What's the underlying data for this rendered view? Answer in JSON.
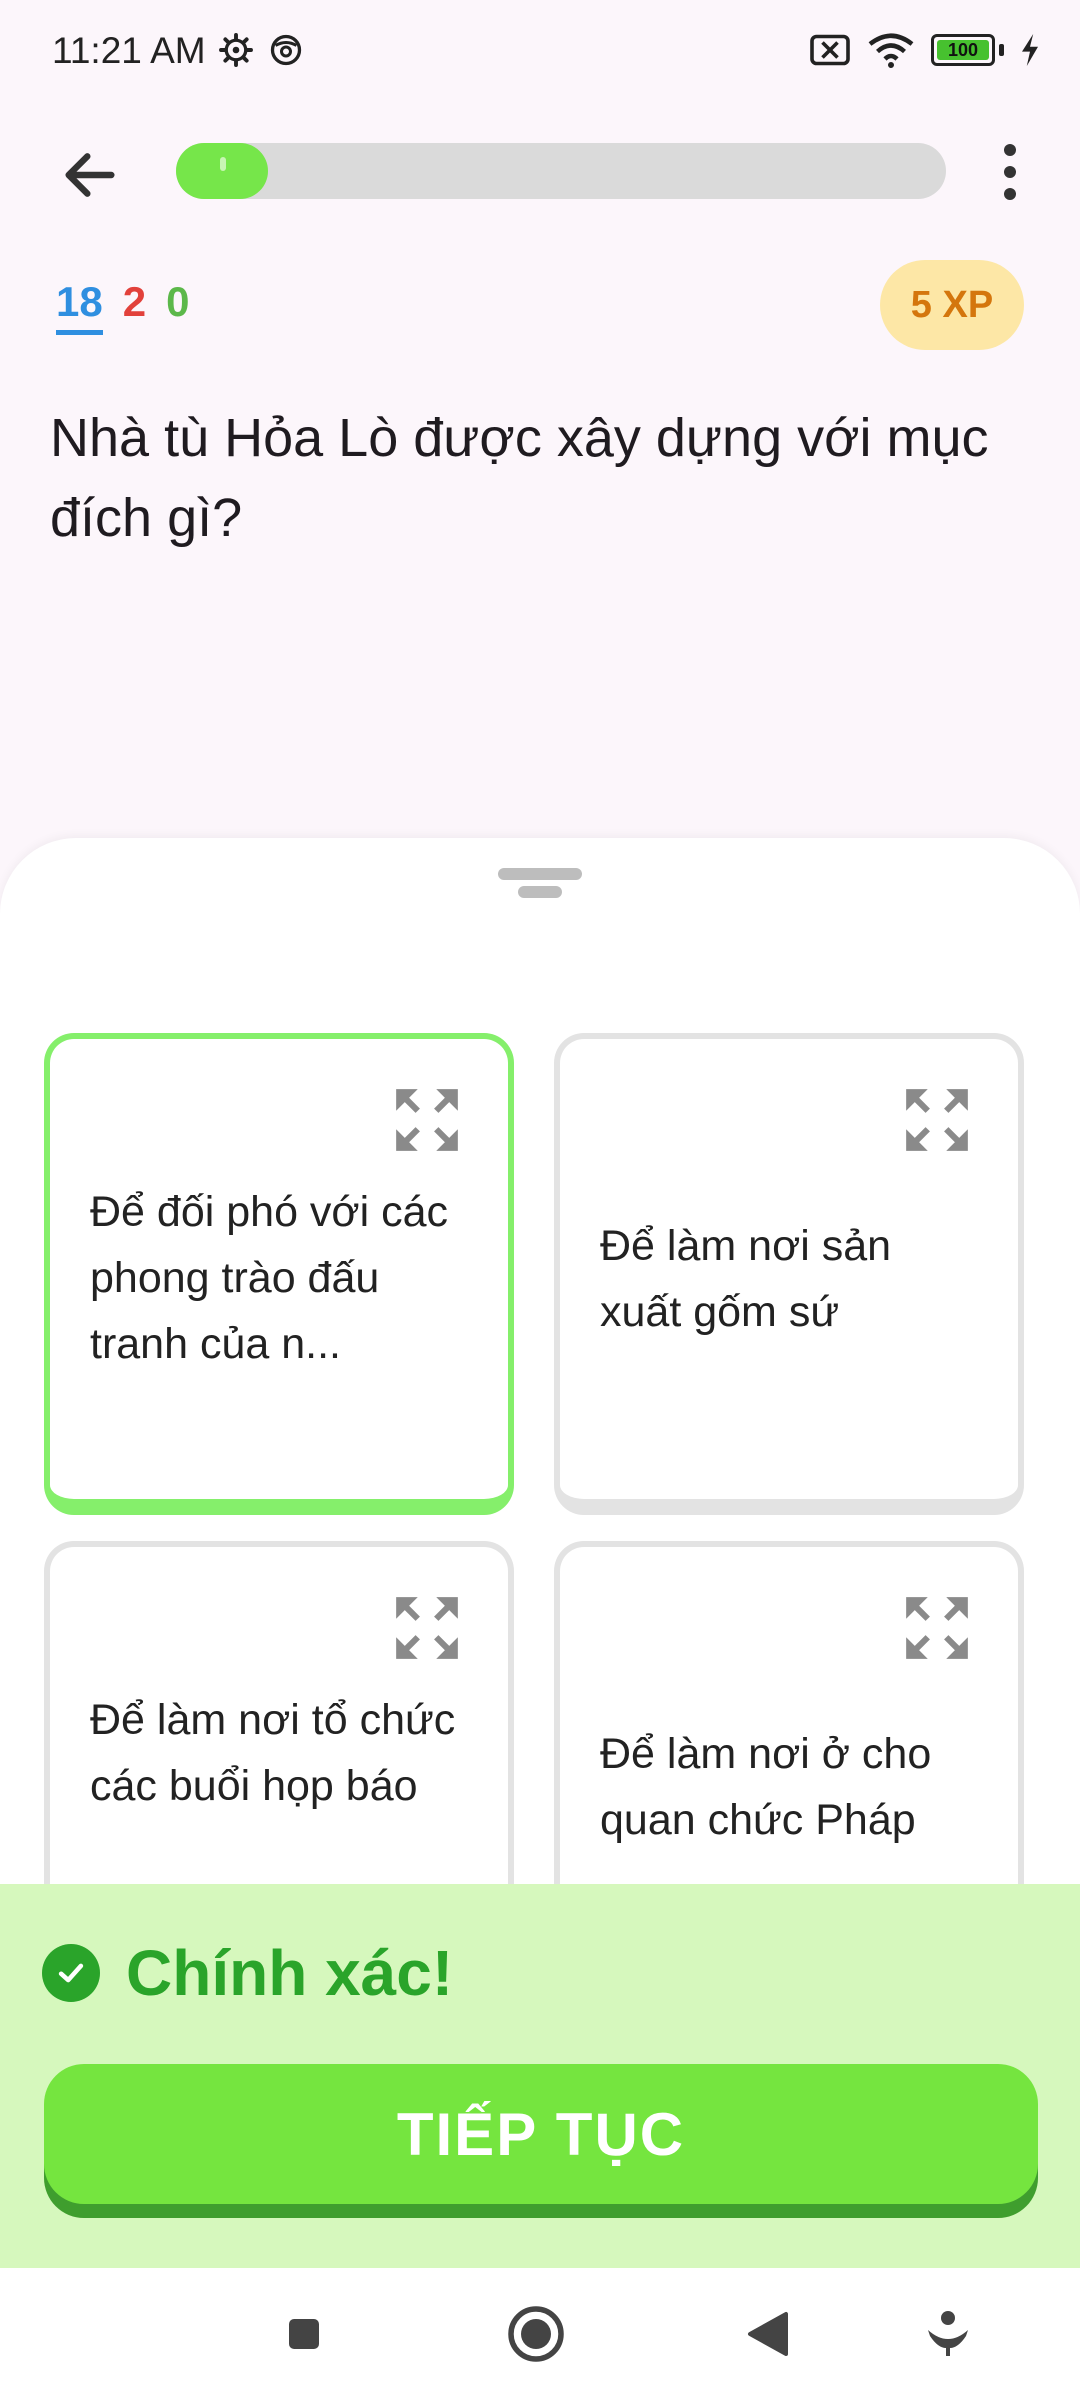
{
  "status_bar": {
    "time": "11:21 AM",
    "battery": "100",
    "icons": [
      "settings-icon",
      "vpn-icon",
      "no-sim-icon",
      "wifi-icon",
      "battery-icon",
      "charging-icon"
    ]
  },
  "header": {
    "progress_fraction": 0.12,
    "icons": [
      "back-arrow-icon",
      "more-vert-icon"
    ]
  },
  "stats": {
    "correct": "18",
    "wrong": "2",
    "skipped": "0",
    "colors": {
      "correct": "#2f8fe0",
      "wrong": "#e2413b",
      "skipped": "#5cb84a"
    }
  },
  "xp_badge": "5 XP",
  "question": "Nhà tù Hỏa Lò được xây dựng với mục đích gì?",
  "answers": [
    {
      "text": "Để đối phó với các phong trào đấu tranh của n...",
      "selected": true
    },
    {
      "text": "Để làm nơi sản xuất gốm sứ",
      "selected": false
    },
    {
      "text": "Để làm nơi tổ chức các buổi họp báo",
      "selected": false
    },
    {
      "text": "Để làm nơi ở cho quan chức Pháp",
      "selected": false
    }
  ],
  "feedback": {
    "text": "Chính xác!",
    "button_label": "TIẾP TỤC",
    "accent": "#75e53f"
  },
  "nav_bar": {
    "icons": [
      "recents-square-icon",
      "home-circle-icon",
      "back-triangle-icon",
      "assistant-icon"
    ]
  }
}
